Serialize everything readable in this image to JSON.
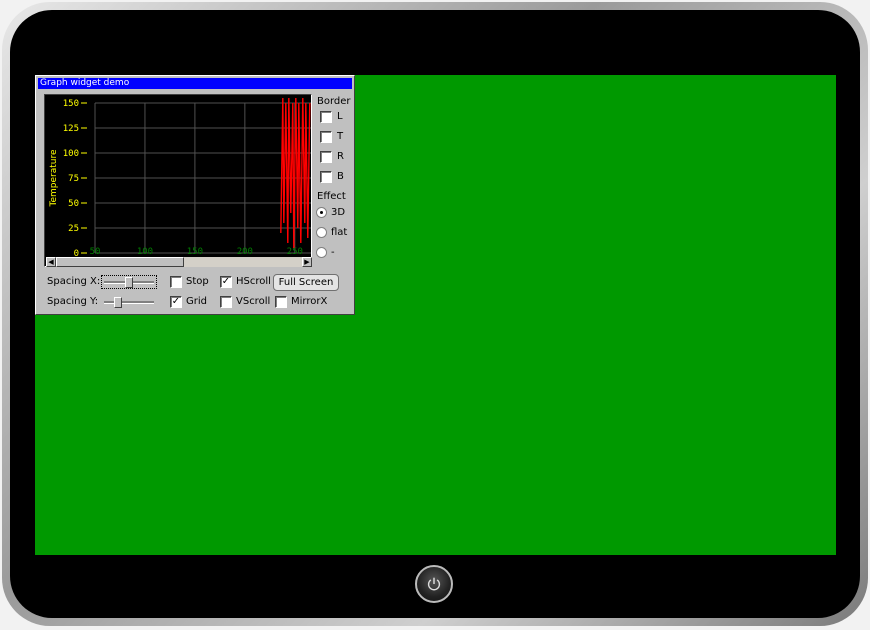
{
  "window": {
    "title": "Graph widget demo"
  },
  "graph": {
    "ylabel": "Temperature",
    "ytick_labels": [
      "150",
      "125",
      "100",
      "75",
      "50",
      "25",
      "0"
    ],
    "xtick_labels": [
      "50",
      "100",
      "150",
      "200",
      "250"
    ],
    "grid": true,
    "colors": {
      "background": "#000000",
      "grid": "#505050",
      "ytick": "#ffff00",
      "xtick": "#008000",
      "trace": "#ff0000"
    }
  },
  "chart_data": {
    "type": "line",
    "ylabel": "Temperature",
    "ylim": [
      0,
      150
    ],
    "x_ticks": [
      50,
      100,
      150,
      200,
      250
    ],
    "series": [
      {
        "x": [
          236,
          238,
          239,
          241,
          243,
          244,
          246,
          248,
          249,
          251,
          253,
          254,
          256,
          258,
          260,
          261,
          263,
          265
        ],
        "values": [
          20,
          155,
          30,
          150,
          10,
          155,
          40,
          150,
          5,
          155,
          25,
          150,
          10,
          155,
          30,
          150,
          15,
          150
        ]
      }
    ]
  },
  "border": {
    "label": "Border",
    "options": [
      "L",
      "T",
      "R",
      "B"
    ]
  },
  "effect": {
    "label": "Effect",
    "options": [
      "3D",
      "flat",
      "-"
    ],
    "selected": "3D"
  },
  "controls": {
    "spacing_x_label": "Spacing X:",
    "spacing_y_label": "Spacing Y:",
    "spacing_x_value": 0.5,
    "spacing_y_value": 0.25,
    "stop": {
      "label": "Stop",
      "checked": false
    },
    "hscroll": {
      "label": "HScroll",
      "checked": true
    },
    "grid": {
      "label": "Grid",
      "checked": true
    },
    "vscroll": {
      "label": "VScroll",
      "checked": false
    },
    "mirrorx": {
      "label": "MirrorX",
      "checked": false
    },
    "fullscreen_label": "Full Screen"
  }
}
